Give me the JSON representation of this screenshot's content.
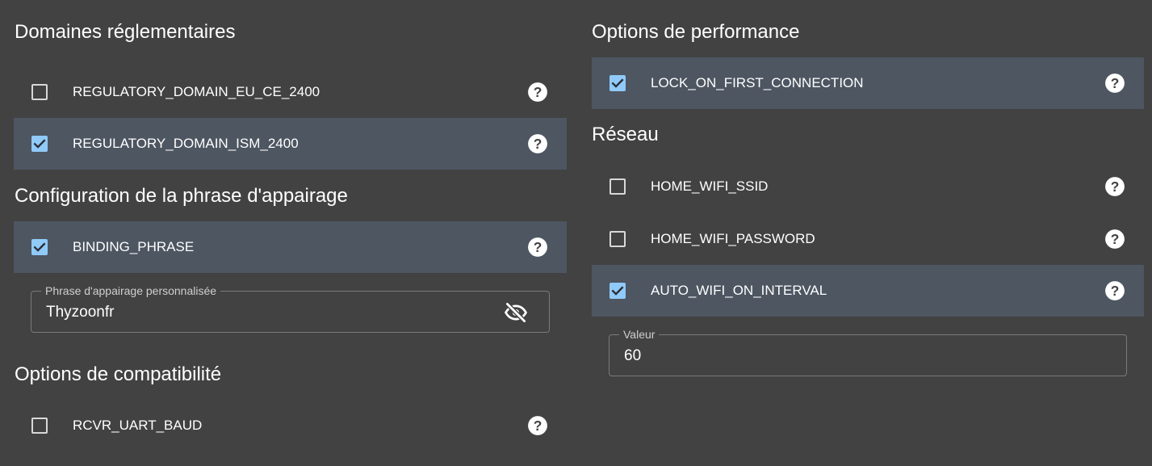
{
  "left": {
    "regulatory": {
      "title": "Domaines réglementaires",
      "items": [
        {
          "label": "REGULATORY_DOMAIN_EU_CE_2400",
          "checked": false
        },
        {
          "label": "REGULATORY_DOMAIN_ISM_2400",
          "checked": true
        }
      ]
    },
    "binding": {
      "title": "Configuration de la phrase d'appairage",
      "items": [
        {
          "label": "BINDING_PHRASE",
          "checked": true
        }
      ],
      "field": {
        "label": "Phrase d'appairage personnalisée",
        "value": "Thyzoonfr"
      }
    },
    "compat": {
      "title": "Options de compatibilité",
      "items": [
        {
          "label": "RCVR_UART_BAUD",
          "checked": false
        }
      ]
    }
  },
  "right": {
    "performance": {
      "title": "Options de performance",
      "items": [
        {
          "label": "LOCK_ON_FIRST_CONNECTION",
          "checked": true
        }
      ]
    },
    "network": {
      "title": "Réseau",
      "items": [
        {
          "label": "HOME_WIFI_SSID",
          "checked": false
        },
        {
          "label": "HOME_WIFI_PASSWORD",
          "checked": false
        },
        {
          "label": "AUTO_WIFI_ON_INTERVAL",
          "checked": true
        }
      ],
      "field": {
        "label": "Valeur",
        "value": "60"
      }
    }
  },
  "colors": {
    "background": "#424242",
    "checked_row": "#4d5661",
    "checkbox_accent": "#90caf9"
  }
}
